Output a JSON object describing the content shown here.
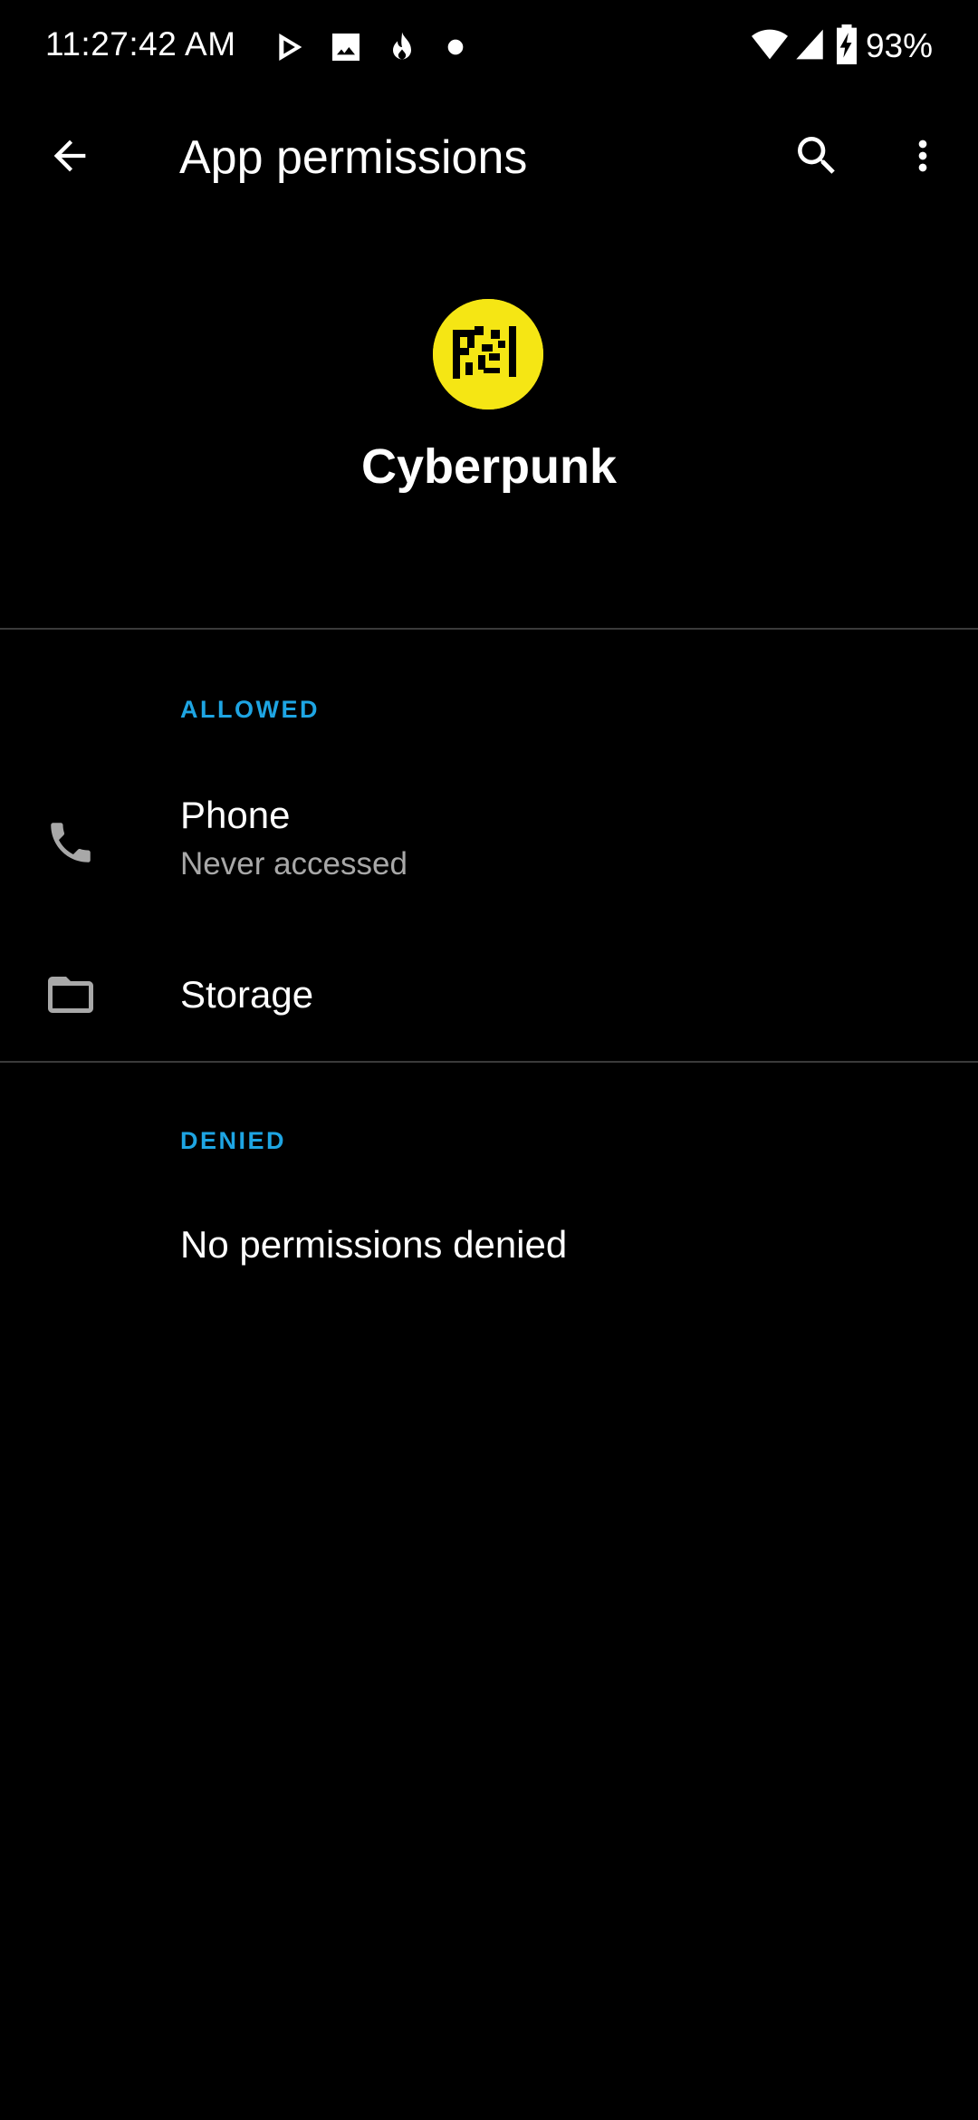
{
  "status_bar": {
    "time": "11:27:42 AM",
    "notification_icons": [
      "play-store-icon",
      "image-icon",
      "flame-icon",
      "dot-icon"
    ],
    "battery_percent": "93%"
  },
  "app_bar": {
    "title": "App permissions",
    "back_icon": "arrow-back-icon",
    "search_icon": "search-icon",
    "more_icon": "more-vert-icon"
  },
  "app": {
    "name": "Cyberpunk",
    "icon_color": "#f5e614"
  },
  "sections": {
    "allowed": {
      "header": "ALLOWED",
      "items": [
        {
          "icon": "phone-icon",
          "title": "Phone",
          "subtitle": "Never accessed"
        },
        {
          "icon": "folder-icon",
          "title": "Storage"
        }
      ]
    },
    "denied": {
      "header": "DENIED",
      "empty_text": "No permissions denied"
    }
  },
  "colors": {
    "background": "#000000",
    "accent": "#1ea5e3",
    "primary_text": "#ffffff",
    "secondary_text": "#a8a8a8",
    "divider": "#3a3a3a"
  }
}
